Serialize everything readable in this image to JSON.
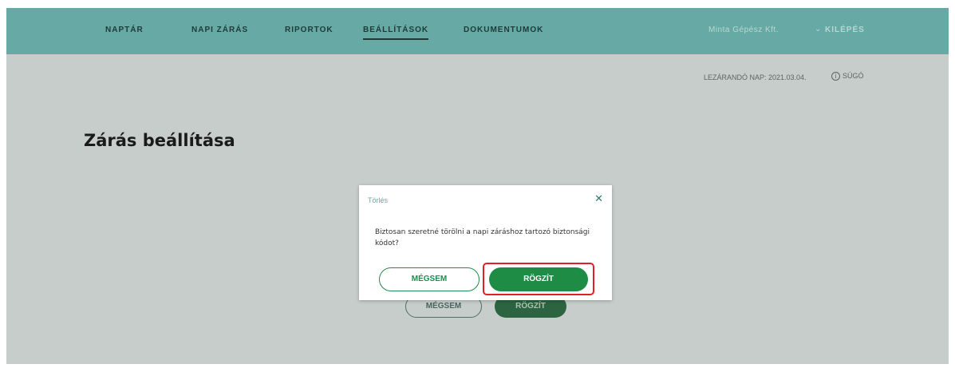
{
  "nav": {
    "items": [
      {
        "label": "NAPTÁR"
      },
      {
        "label": "NAPI ZÁRÁS"
      },
      {
        "label": "RIPORTOK"
      },
      {
        "label": "BEÁLLÍTÁSOK"
      },
      {
        "label": "DOKUMENTUMOK"
      }
    ],
    "active": "BEÁLLÍTÁSOK",
    "user": "Minta Gépész Kft.",
    "help": "KILÉPÉS"
  },
  "header": {
    "closing_day": "LEZÁRANDÓ NAP: 2021.03.04.",
    "help_link": "SÚGÓ"
  },
  "page": {
    "title": "Zárás beállítása",
    "cancel_label": "MÉGSEM",
    "save_label": "RÖGZÍT"
  },
  "modal": {
    "title": "Törlés",
    "message": "Biztosan szeretné törölni a napi záráshoz tartozó biztonsági kódot?",
    "cancel_label": "MÉGSEM",
    "confirm_label": "RÖGZÍT"
  },
  "colors": {
    "nav_bg": "#67aaa5",
    "overlay": "#c6cdcb",
    "primary": "#1f8c45",
    "highlight": "#e01f26"
  }
}
